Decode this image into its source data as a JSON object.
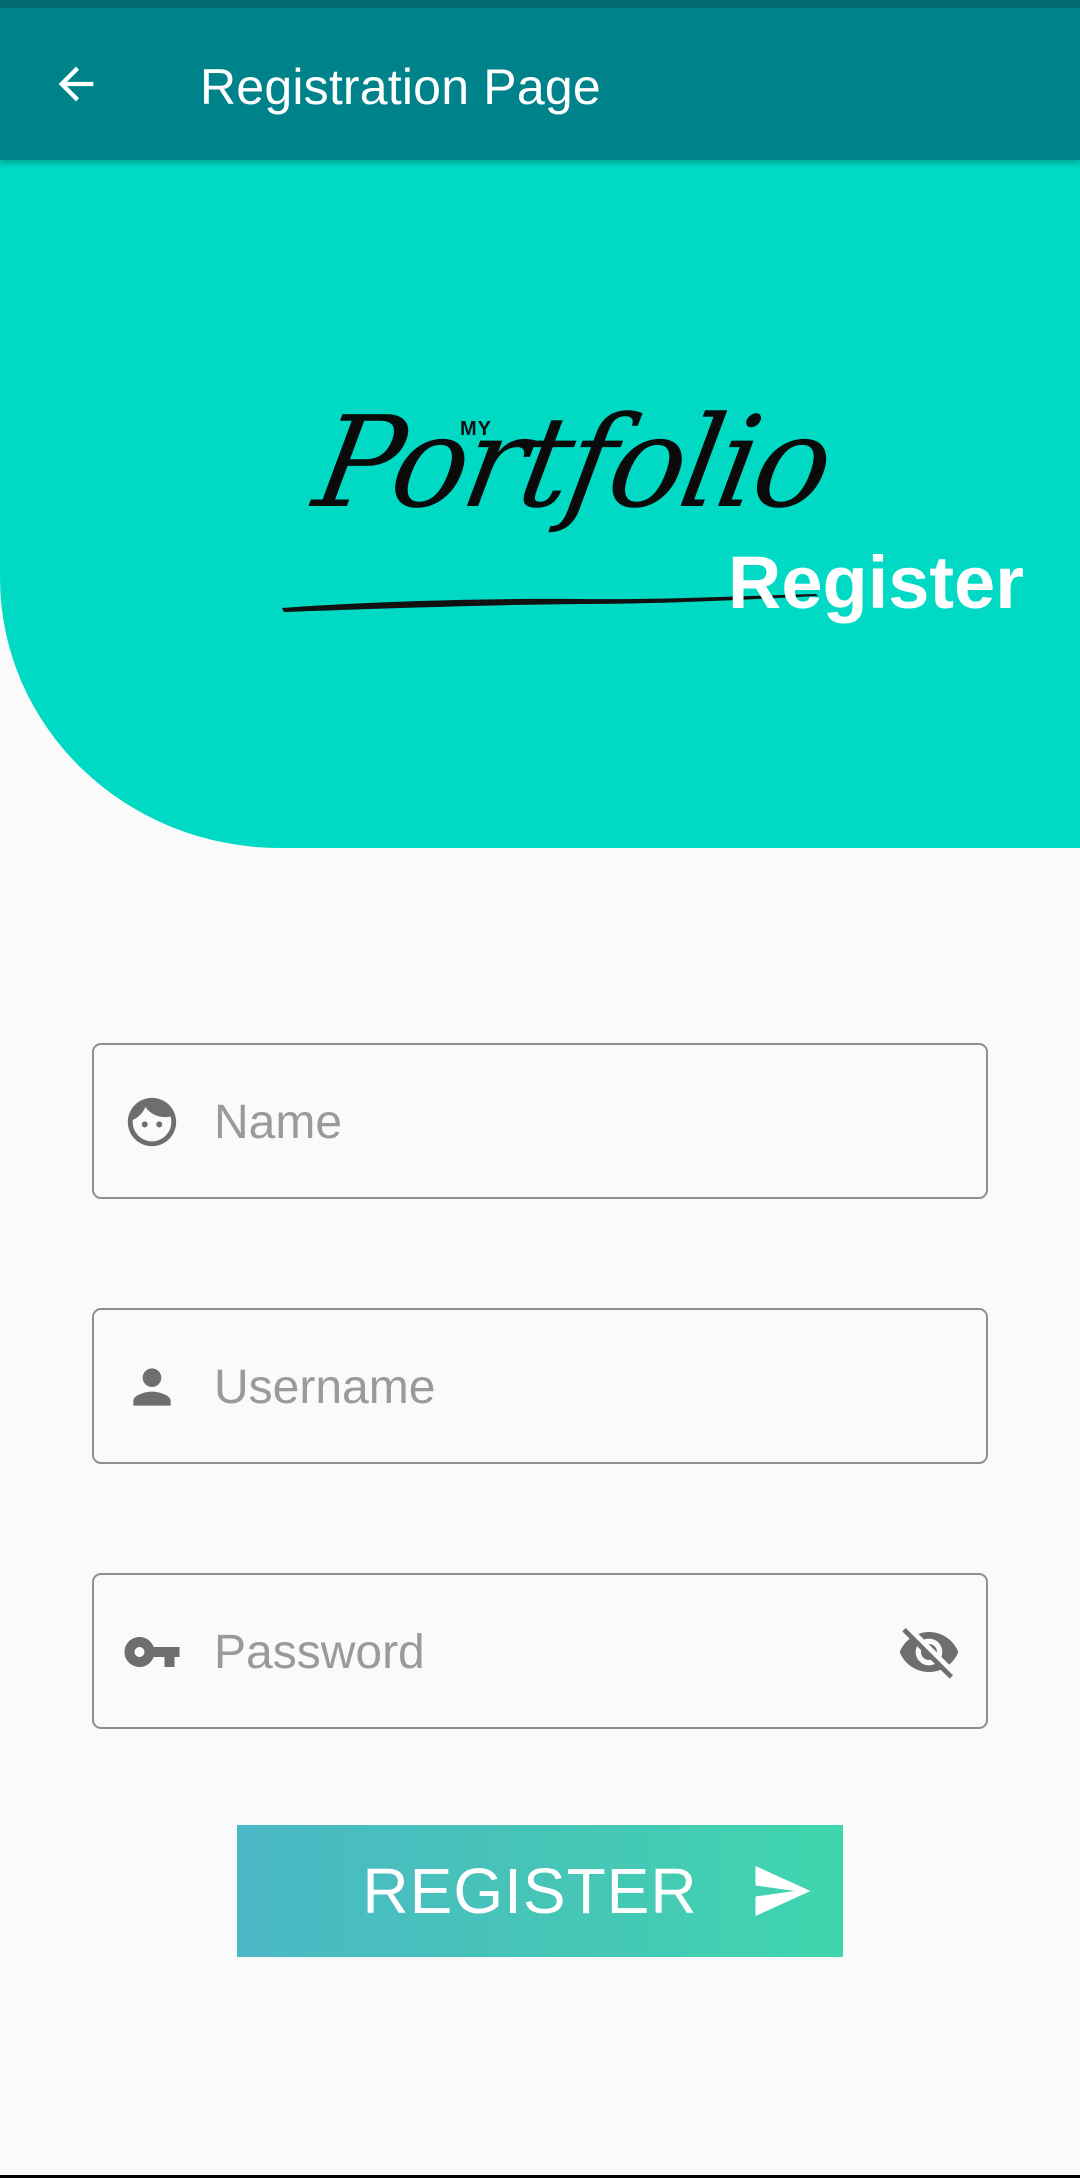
{
  "app_bar": {
    "title": "Registration Page",
    "back_icon": "arrow-back-icon",
    "color": "#00828a"
  },
  "hero": {
    "logo_small": "MY",
    "logo_word": "Portfolio",
    "heading": "Register",
    "color": "#00d9c4"
  },
  "form": {
    "name": {
      "placeholder": "Name",
      "icon": "face-icon"
    },
    "username": {
      "placeholder": "Username",
      "icon": "person-icon"
    },
    "password": {
      "placeholder": "Password",
      "icon": "key-icon",
      "toggle_icon": "visibility-off-icon"
    }
  },
  "register_button": {
    "label": "REGISTER",
    "icon": "send-icon",
    "gradient_start": "#4ab8c6",
    "gradient_end": "#3fd6ae"
  }
}
